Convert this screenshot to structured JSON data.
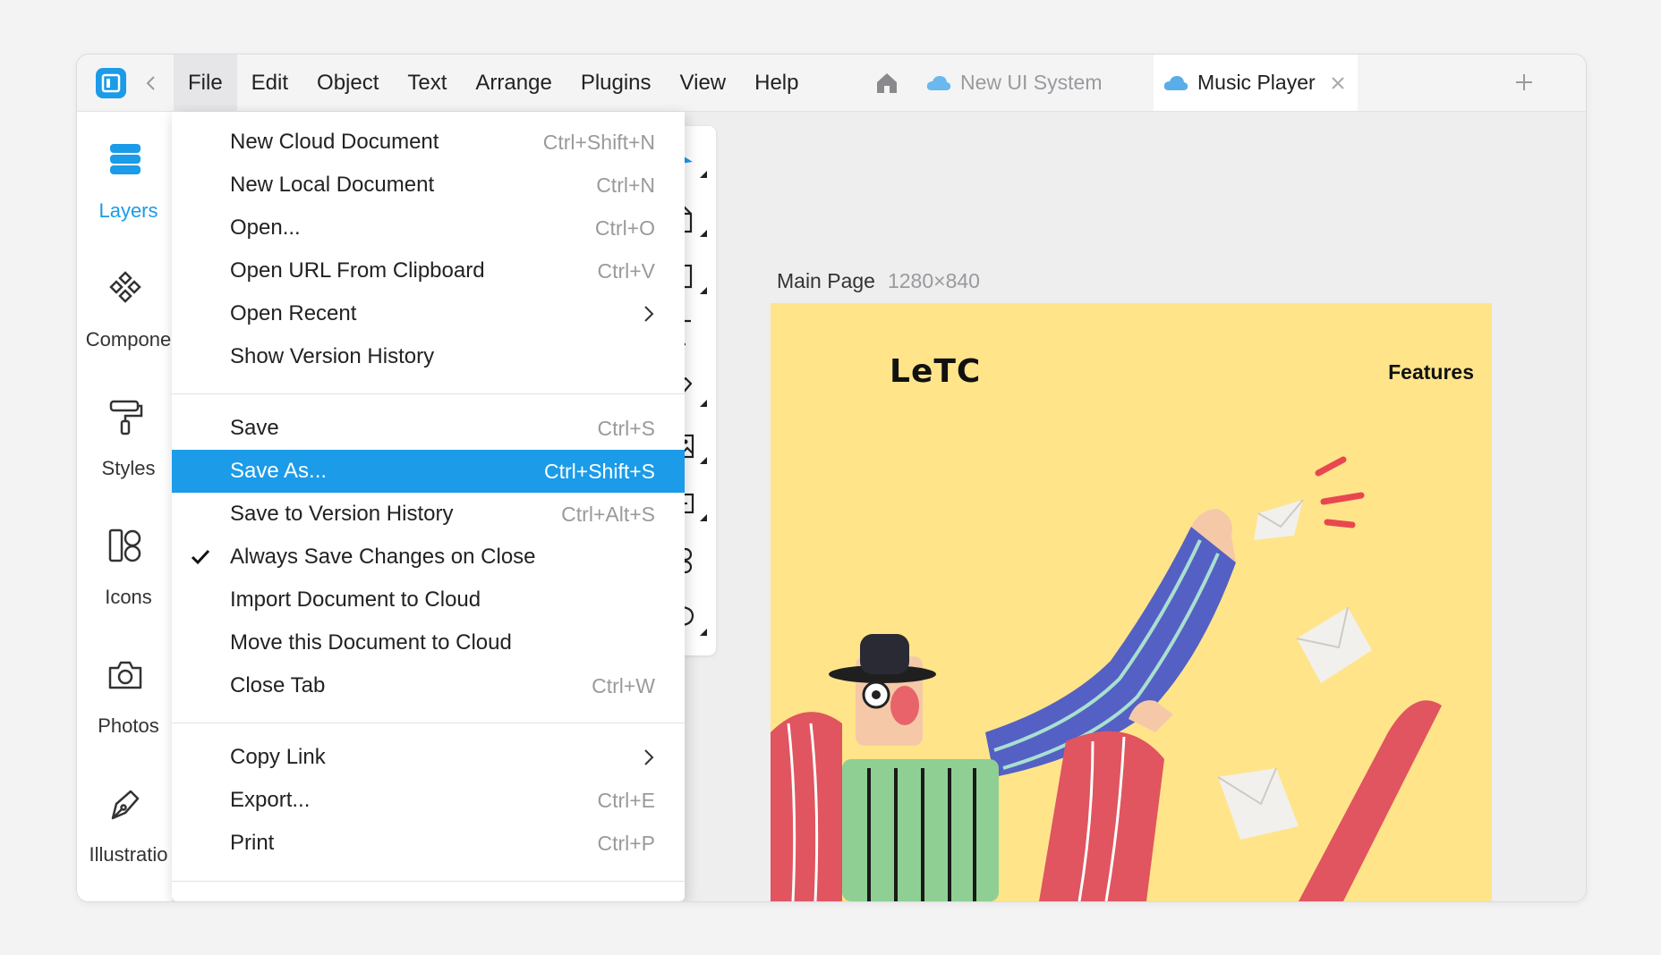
{
  "menubar": {
    "items": [
      "File",
      "Edit",
      "Object",
      "Text",
      "Arrange",
      "Plugins",
      "View",
      "Help"
    ],
    "active": "File"
  },
  "tabs": [
    {
      "label": "New UI System",
      "active": false
    },
    {
      "label": "Music Player",
      "active": true
    }
  ],
  "sidebar": {
    "items": [
      {
        "label": "Layers",
        "icon": "layers-icon",
        "active": true
      },
      {
        "label": "Compone",
        "icon": "components-icon",
        "active": false
      },
      {
        "label": "Styles",
        "icon": "paint-roller-icon",
        "active": false
      },
      {
        "label": "Icons",
        "icon": "icons-icon",
        "active": false
      },
      {
        "label": "Photos",
        "icon": "camera-icon",
        "active": false
      },
      {
        "label": "Illustratio",
        "icon": "pen-nib-icon",
        "active": false
      }
    ]
  },
  "file_menu": {
    "items": [
      {
        "label": "New Cloud Document",
        "shortcut": "Ctrl+Shift+N"
      },
      {
        "label": "New Local Document",
        "shortcut": "Ctrl+N"
      },
      {
        "label": "Open...",
        "shortcut": "Ctrl+O"
      },
      {
        "label": "Open URL From Clipboard",
        "shortcut": "Ctrl+V"
      },
      {
        "label": "Open Recent",
        "submenu": true
      },
      {
        "label": "Show Version History"
      },
      {
        "label": "Save",
        "shortcut": "Ctrl+S"
      },
      {
        "label": "Save As...",
        "shortcut": "Ctrl+Shift+S",
        "highlighted": true
      },
      {
        "label": "Save to Version History",
        "shortcut": "Ctrl+Alt+S"
      },
      {
        "label": "Always Save Changes on Close",
        "checked": true
      },
      {
        "label": "Import Document to Cloud"
      },
      {
        "label": "Move this Document to Cloud"
      },
      {
        "label": "Close Tab",
        "shortcut": "Ctrl+W"
      },
      {
        "label": "Copy Link",
        "submenu": true
      },
      {
        "label": "Export...",
        "shortcut": "Ctrl+E"
      },
      {
        "label": "Print",
        "shortcut": "Ctrl+P"
      }
    ]
  },
  "canvas": {
    "frame_name": "Main Page",
    "frame_size": "1280×840",
    "artboard": {
      "logo": "LeTC",
      "nav": "Features",
      "background": "#ffe48a"
    }
  },
  "colors": {
    "accent": "#1b9be8",
    "menu_highlight": "#1b9be8"
  }
}
